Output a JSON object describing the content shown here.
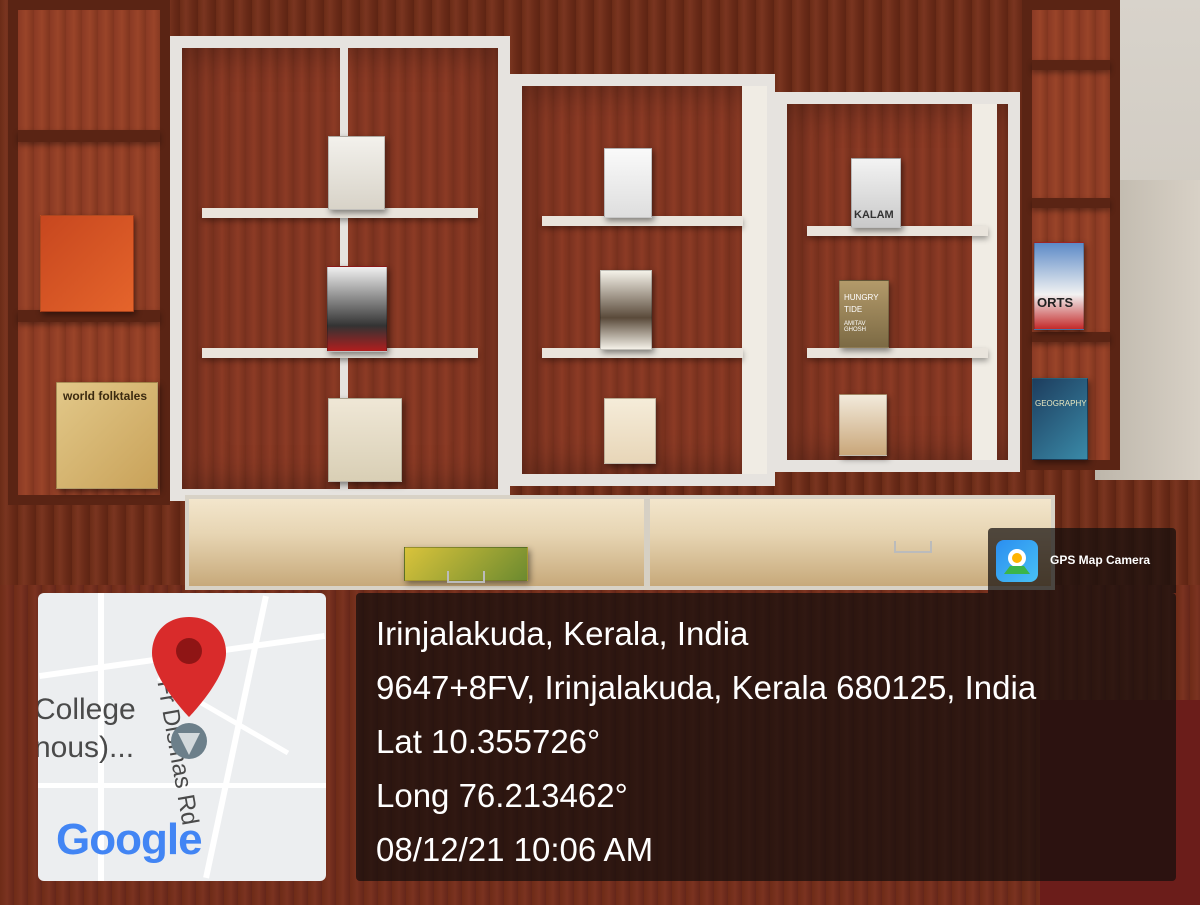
{
  "overlay": {
    "badge_label": "GPS Map Camera",
    "place": "Irinjalakuda, Kerala, India",
    "address": "9647+8FV, Irinjalakuda, Kerala 680125, India",
    "latitude": "Lat 10.355726°",
    "longitude": "Long 76.213462°",
    "timestamp": "08/12/21 10:06 AM"
  },
  "map": {
    "road_label": "Fr Dismas Rd",
    "poi_line1": "College",
    "poi_line2": "nous)...",
    "brand": "Google",
    "pin_color": "#d92b2b"
  },
  "books": {
    "kalam": "KALAM",
    "hungry_tide_1": "HUNGRY",
    "hungry_tide_2": "TIDE",
    "author": "AMITAV GHOSH",
    "world_folktales": "world folktales",
    "sports": "ORTS",
    "geography": "GEOGRAPHY"
  }
}
